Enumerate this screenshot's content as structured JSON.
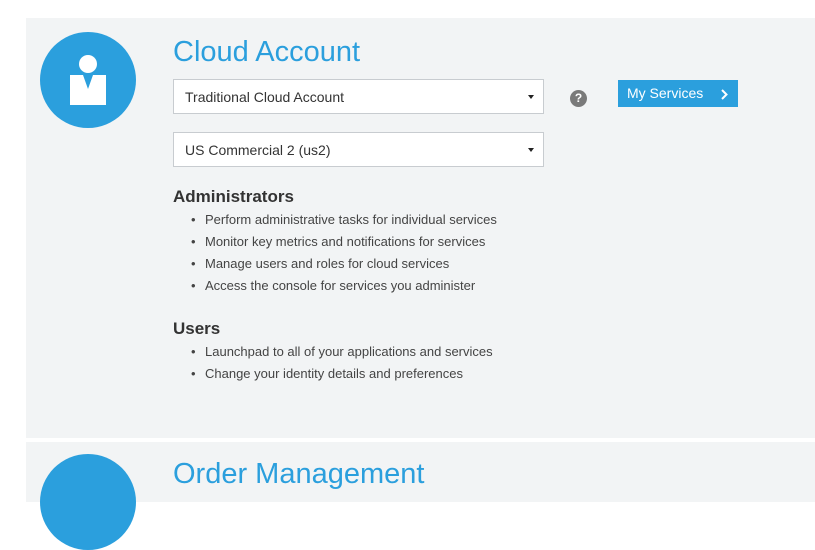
{
  "cloud_account": {
    "title": "Cloud Account",
    "account_type": {
      "selected": "Traditional Cloud Account"
    },
    "region": {
      "selected": "US Commercial 2 (us2)"
    },
    "help_icon": "?",
    "my_services_label": "My Services",
    "administrators": {
      "heading": "Administrators",
      "items": [
        "Perform administrative tasks for individual services",
        "Monitor key metrics and notifications for services",
        "Manage users and roles for cloud services",
        "Access the console for services you administer"
      ]
    },
    "users": {
      "heading": "Users",
      "items": [
        "Launchpad to all of your applications and services",
        "Change your identity details and preferences"
      ]
    }
  },
  "order_management": {
    "title": "Order Management"
  },
  "icons": {
    "account": "user-icon",
    "help": "question-icon",
    "chevron": "chevron-right-icon",
    "caret": "caret-down-icon"
  },
  "colors": {
    "accent": "#2b9fdd",
    "panel": "#f2f4f5",
    "help_icon": "#7a7a7a"
  }
}
